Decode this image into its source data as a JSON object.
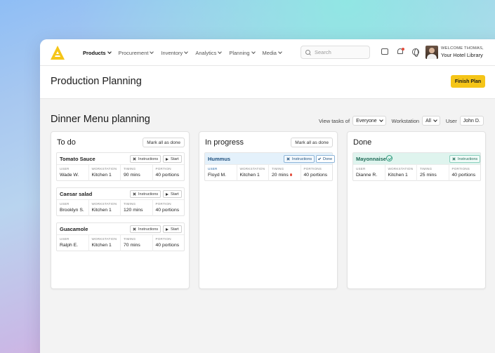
{
  "nav": {
    "items": [
      {
        "label": "Products",
        "active": true
      },
      {
        "label": "Procurement",
        "active": false
      },
      {
        "label": "Inventory",
        "active": false
      },
      {
        "label": "Analytics",
        "active": false
      },
      {
        "label": "Planning",
        "active": false
      },
      {
        "label": "Media",
        "active": false
      }
    ],
    "search_placeholder": "Search",
    "welcome_line": "WELCOME THOMAS,",
    "org_name": "Your Hotel Library"
  },
  "page": {
    "title": "Production Planning",
    "finish_label": "Finish Plan",
    "accent_color": "#f5c518"
  },
  "section": {
    "title": "Dinner Menu planning",
    "filters": {
      "view_label": "View tasks of",
      "view_value": "Everyone",
      "workstation_label": "Workstation",
      "workstation_value": "All",
      "user_label": "User",
      "user_value": "John D."
    }
  },
  "columns": [
    {
      "title": "To do",
      "mark_all_label": "Mark all as done",
      "tasks": [
        {
          "name": "Tomato Sauce",
          "instructions_label": "Instructions",
          "action_label": "Start",
          "fields": [
            {
              "label": "USER",
              "value": "Wade W."
            },
            {
              "label": "WORKSTATION",
              "value": "Kitchen 1"
            },
            {
              "label": "TIMING",
              "value": "90 mins"
            },
            {
              "label": "PORTION",
              "value": "40 portions"
            }
          ]
        },
        {
          "name": "Caesar salad",
          "instructions_label": "Instructions",
          "action_label": "Start",
          "fields": [
            {
              "label": "USER",
              "value": "Brooklyn S."
            },
            {
              "label": "WORKSTATION",
              "value": "Kitchen 1"
            },
            {
              "label": "TIMING",
              "value": "120 mins"
            },
            {
              "label": "PORTION",
              "value": "40 portions"
            }
          ]
        },
        {
          "name": "Guacamole",
          "instructions_label": "Instructions",
          "action_label": "Start",
          "fields": [
            {
              "label": "USER",
              "value": "Ralph E."
            },
            {
              "label": "WORKSTATION",
              "value": "Kitchen 1"
            },
            {
              "label": "TIMING",
              "value": "70 mins"
            },
            {
              "label": "PORTION",
              "value": "40 portions"
            }
          ]
        }
      ]
    },
    {
      "title": "In progress",
      "mark_all_label": "Mark all as done",
      "tasks": [
        {
          "name": "Hummus",
          "instructions_label": "Instructions",
          "action_label": "Done",
          "fields": [
            {
              "label": "USER",
              "value": "Floyd M."
            },
            {
              "label": "WORKSTATION",
              "value": "Kitchen 1"
            },
            {
              "label": "TIMING",
              "value": "20 mins"
            },
            {
              "label": "PORTIONS",
              "value": "40 portions"
            }
          ]
        }
      ]
    },
    {
      "title": "Done",
      "tasks": [
        {
          "name": "Mayonnaise",
          "instructions_label": "Instructions",
          "fields": [
            {
              "label": "USER",
              "value": "Dianne R."
            },
            {
              "label": "WORKSTATION",
              "value": "Kitchen 1"
            },
            {
              "label": "TIMING",
              "value": "25 mins"
            },
            {
              "label": "PORTIONS",
              "value": "40 portions"
            }
          ]
        }
      ]
    }
  ]
}
